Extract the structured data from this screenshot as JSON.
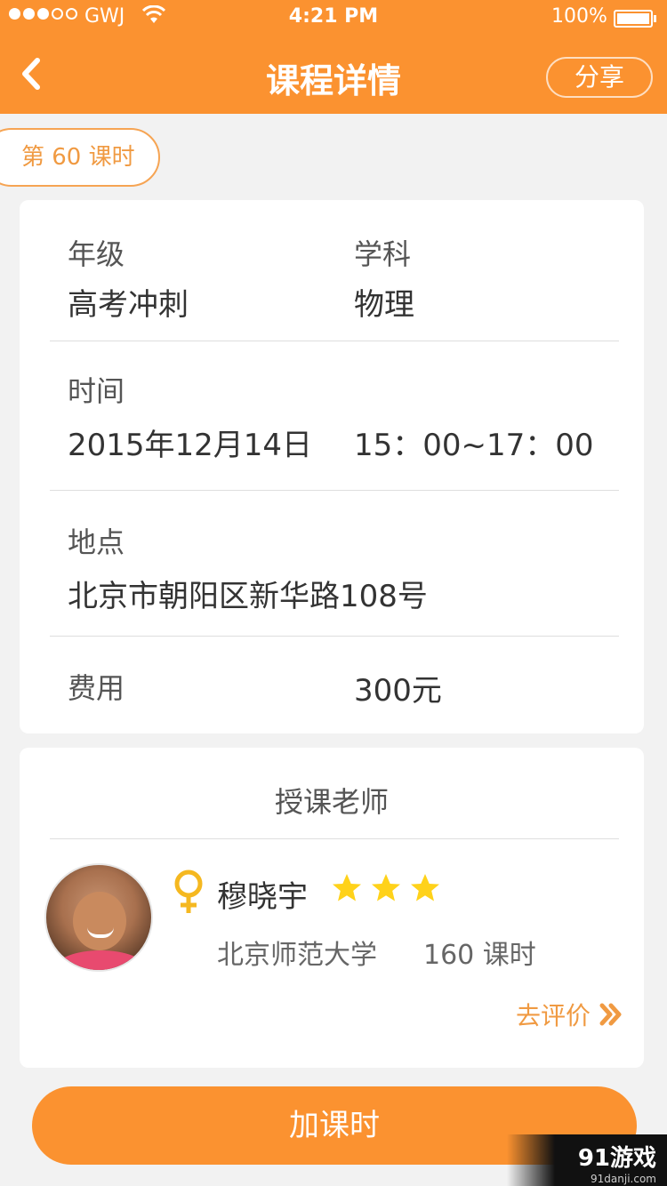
{
  "status": {
    "carrier": "GWJ",
    "time": "4:21 PM",
    "battery": "100%"
  },
  "nav": {
    "title": "课程详情",
    "share_label": "分享"
  },
  "lesson_tag": "第 60 课时",
  "details": {
    "grade_label": "年级",
    "grade_value": "高考冲刺",
    "subject_label": "学科",
    "subject_value": "物理",
    "time_label": "时间",
    "date_value": "2015年12月14日",
    "time_value": "15：00~17：00",
    "place_label": "地点",
    "place_value": "北京市朝阳区新华路108号",
    "fee_label": "费用",
    "fee_value": "300元"
  },
  "teacher": {
    "section_title": "授课老师",
    "name": "穆晓宇",
    "rating": 3,
    "school": "北京师范大学",
    "hours": "160 课时",
    "rate_label": "去评价"
  },
  "add_button_label": "加课时",
  "watermark": {
    "text": "91游戏",
    "sub": "91danji.com"
  },
  "colors": {
    "accent": "#fb9230",
    "star": "#ffd21a",
    "tag_text": "#f09a42"
  }
}
